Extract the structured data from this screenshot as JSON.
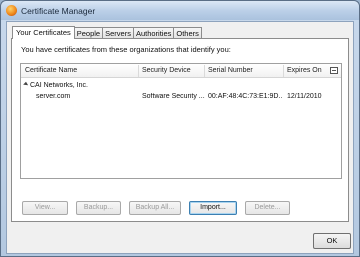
{
  "window": {
    "title": "Certificate Manager"
  },
  "tabs": [
    {
      "label": "Your Certificates",
      "active": true
    },
    {
      "label": "People"
    },
    {
      "label": "Servers"
    },
    {
      "label": "Authorities"
    },
    {
      "label": "Others"
    }
  ],
  "panel": {
    "intro": "You have certificates from these organizations that identify you:",
    "columns": [
      "Certificate Name",
      "Security Device",
      "Serial Number",
      "Expires On"
    ],
    "groups": [
      {
        "name": "CAI Networks, Inc.",
        "rows": [
          {
            "name": "server.com",
            "device": "Software Security ...",
            "serial": "00:AF:48:4C:73:E1:9D...",
            "expires": "12/11/2010"
          }
        ]
      }
    ]
  },
  "buttons": {
    "view": "View...",
    "backup": "Backup...",
    "backup_all": "Backup All...",
    "import": "Import...",
    "delete": "Delete...",
    "ok": "OK"
  },
  "icons": {
    "app": "firefox-icon",
    "column_picker": "column-picker-icon",
    "twisty": "tree-expanded-icon"
  }
}
